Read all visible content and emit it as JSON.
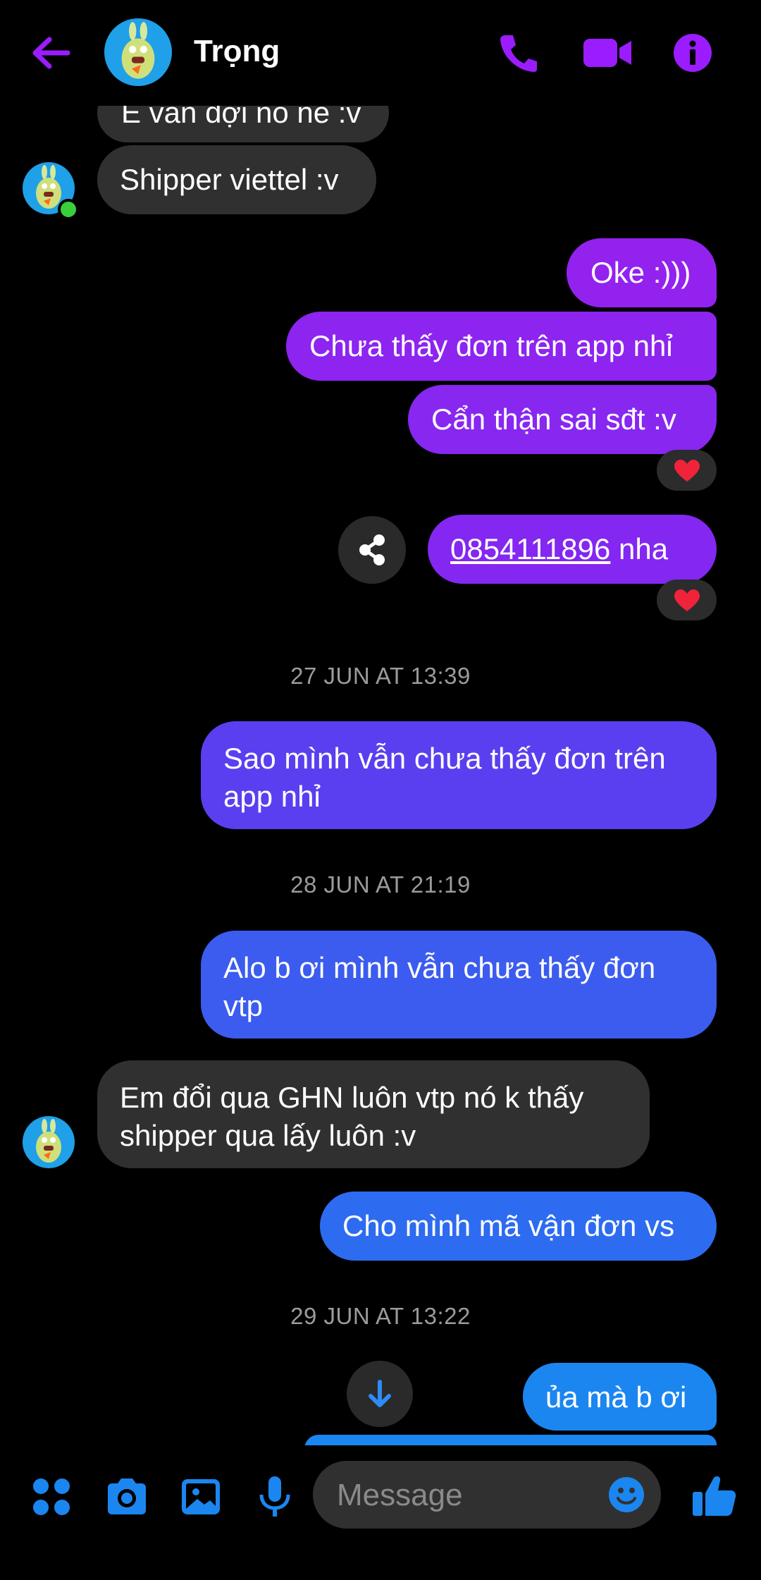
{
  "header": {
    "contact_name": "Trọng",
    "back_icon": "arrow-left-icon",
    "call_icon": "phone-icon",
    "video_icon": "video-camera-icon",
    "info_icon": "info-icon",
    "accent": "#9b1cff"
  },
  "messages": {
    "partial_top": "E vẫn đợi nó nè :v",
    "shipper": "Shipper viettel :v",
    "oke": "Oke :)))",
    "chua_thay": "Chưa thấy đơn trên app nhỉ",
    "can_than": "Cẩn thận sai sđt :v",
    "phone_number": "0854111896",
    "phone_suffix": " nha",
    "sao_minh_l1": "Sao mình vẫn chưa thấy đơn trên",
    "sao_minh_l2": "app nhỉ",
    "alo_l1": "Alo b ơi mình vẫn chưa thấy đơn",
    "alo_l2": "vtp",
    "em_doi_l1": "Em đổi qua GHN luôn vtp nó k thấy",
    "em_doi_l2": "shipper qua lấy luôn :v",
    "cho_minh": "Cho mình mã vận đơn vs",
    "ua_ma": "ủa mà b ơi"
  },
  "timestamps": {
    "t1": "27 JUN AT 13:39",
    "t2": "28 JUN AT 21:19",
    "t3": "29 JUN AT 13:22"
  },
  "reactions": {
    "r1": "heart",
    "r2": "heart"
  },
  "composer": {
    "placeholder": "Message",
    "icons": [
      "menu-dots-icon",
      "camera-icon",
      "image-icon",
      "microphone-icon",
      "emoji-icon",
      "thumbs-up-icon"
    ],
    "accent": "#1b86f0"
  }
}
